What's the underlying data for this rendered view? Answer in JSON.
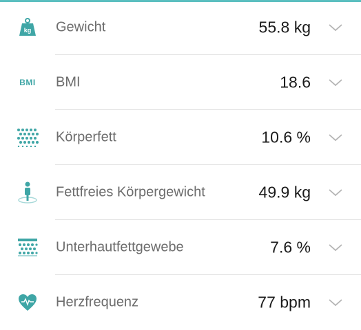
{
  "accent_color": "#3fa6a6",
  "rows": [
    {
      "icon": "kg-weight-icon",
      "icon_text": "kg",
      "label": "Gewicht",
      "value": "55.8 kg"
    },
    {
      "icon": "bmi-icon",
      "icon_text": "BMI",
      "label": "BMI",
      "value": "18.6"
    },
    {
      "icon": "body-fat-dots-icon",
      "label": "Körperfett",
      "value": "10.6 %"
    },
    {
      "icon": "lean-body-person-icon",
      "label": "Fettfreies Körpergewicht",
      "value": "49.9 kg"
    },
    {
      "icon": "subcutaneous-fat-icon",
      "label": "Unterhautfettgewebe",
      "value": "7.6 %"
    },
    {
      "icon": "heart-rate-icon",
      "label": "Herzfrequenz",
      "value": "77 bpm"
    }
  ]
}
